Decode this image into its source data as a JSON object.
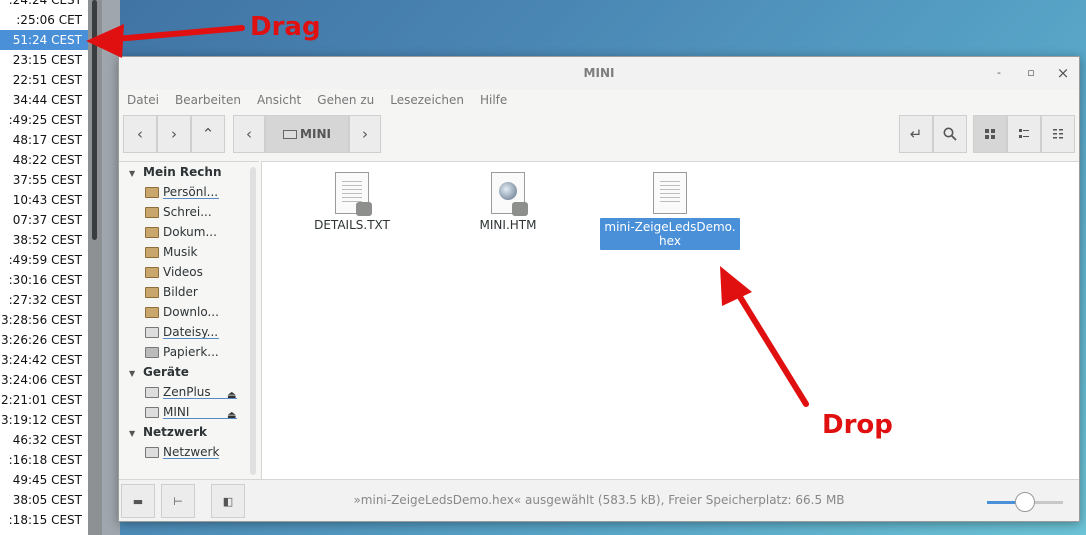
{
  "left_list": {
    "rows": [
      ":24:24 CEST",
      ":25:06 CET",
      "51:24 CEST",
      "23:15 CEST",
      "22:51 CEST",
      "34:44 CEST",
      ":49:25 CEST",
      "48:17 CEST",
      "48:22 CEST",
      "37:55 CEST",
      "10:43 CEST",
      "07:37 CEST",
      "38:52 CEST",
      ":49:59 CEST",
      ":30:16 CEST",
      ":27:32 CEST",
      "3:28:56 CEST",
      "3:26:26 CEST",
      "3:24:42 CEST",
      "3:24:06 CEST",
      "2:21:01 CEST",
      "3:19:12 CEST",
      "46:32 CEST",
      ":16:18 CEST",
      "49:45 CEST",
      "38:05 CEST",
      ":18:15 CEST"
    ],
    "selected_index": 2
  },
  "window": {
    "title": "MINI",
    "controls": {
      "minimize": "-",
      "maximize": "▫",
      "close": "×"
    }
  },
  "menu": [
    "Datei",
    "Bearbeiten",
    "Ansicht",
    "Gehen zu",
    "Lesezeichen",
    "Hilfe"
  ],
  "toolbar": {
    "path_label": "MINI",
    "view_mode": "icons"
  },
  "sidebar": {
    "sections": [
      {
        "title": "Mein Rechn",
        "items": [
          {
            "label": "Persönl...",
            "underline": true
          },
          {
            "label": "Schrei...",
            "underline": false
          },
          {
            "label": "Dokum...",
            "underline": false
          },
          {
            "label": "Musik",
            "underline": false
          },
          {
            "label": "Videos",
            "underline": false
          },
          {
            "label": "Bilder",
            "underline": false
          },
          {
            "label": "Downlo...",
            "underline": false
          },
          {
            "label": "Dateisy...",
            "underline": true
          },
          {
            "label": "Papierk...",
            "underline": false
          }
        ]
      },
      {
        "title": "Geräte",
        "items": [
          {
            "label": "ZenPlus",
            "underline": true
          },
          {
            "label": "MINI",
            "underline": true
          }
        ]
      },
      {
        "title": "Netzwerk",
        "items": [
          {
            "label": "Netzwerk",
            "underline": true
          }
        ]
      }
    ]
  },
  "files": [
    {
      "name": "DETAILS.TXT",
      "type": "text-locked",
      "selected": false
    },
    {
      "name": "MINI.HTM",
      "type": "html-locked",
      "selected": false
    },
    {
      "name": "mini-ZeigeLedsDemo.hex",
      "type": "text",
      "selected": true
    }
  ],
  "status": {
    "text": "»mini-ZeigeLedsDemo.hex« ausgewählt (583.5 kB), Freier Speicherplatz: 66.5 MB",
    "zoom_fraction": 0.5
  },
  "annotations": {
    "drag_label": "Drag",
    "drop_label": "Drop",
    "color": "#e01010"
  }
}
